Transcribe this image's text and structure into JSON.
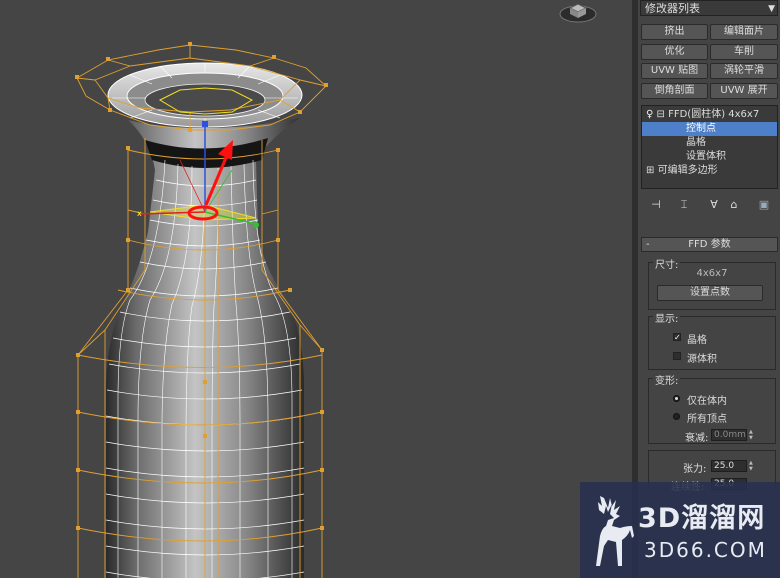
{
  "panel": {
    "modifier_list": "修改器列表",
    "buttons": [
      {
        "label": "挤出"
      },
      {
        "label": "编辑面片"
      },
      {
        "label": "优化"
      },
      {
        "label": "车削"
      },
      {
        "label": "UVW 贴图"
      },
      {
        "label": "涡轮平滑"
      },
      {
        "label": "倒角剖面"
      },
      {
        "label": "UVW 展开"
      }
    ],
    "stack": {
      "items": [
        {
          "label": "FFD(圆柱体) 4x6x7",
          "level": 0,
          "expander": "⊟",
          "selected": false
        },
        {
          "label": "控制点",
          "level": 1,
          "selected": true
        },
        {
          "label": "晶格",
          "level": 1,
          "selected": false
        },
        {
          "label": "设置体积",
          "level": 1,
          "selected": false
        },
        {
          "label": "可编辑多边形",
          "level": 0,
          "expander": "⊞",
          "selected": false
        }
      ]
    },
    "ffd": {
      "title": "FFD 参数",
      "collapse_sign": "-",
      "dimensions_label": "尺寸:",
      "dimensions_value": "4x6x7",
      "set_points_button": "设置点数",
      "display_label": "显示:",
      "lattice_label": "晶格",
      "lattice_checked": true,
      "source_volume_label": "源体积",
      "source_volume_checked": false,
      "deform_label": "变形:",
      "only_in_volume_label": "仅在体内",
      "all_vertices_label": "所有顶点",
      "selected_deform": "only_in_volume",
      "falloff_label": "衰减:",
      "falloff_value": "0.0mm",
      "tension_label": "张力:",
      "tension_value": "25.0",
      "continuity_label": "连续性:",
      "continuity_value": "25.0"
    }
  },
  "watermark": {
    "big": "3D溜溜网",
    "small": "3D66.COM"
  },
  "colors": {
    "viewport_bg": "#454545",
    "lattice": "#e0a030",
    "wire": "#ffffff",
    "selection": "#4d80c8",
    "gizmo_x": "#e02020",
    "gizmo_y": "#30c030",
    "gizmo_z": "#3050e0",
    "highlight_red": "#ff1010"
  }
}
